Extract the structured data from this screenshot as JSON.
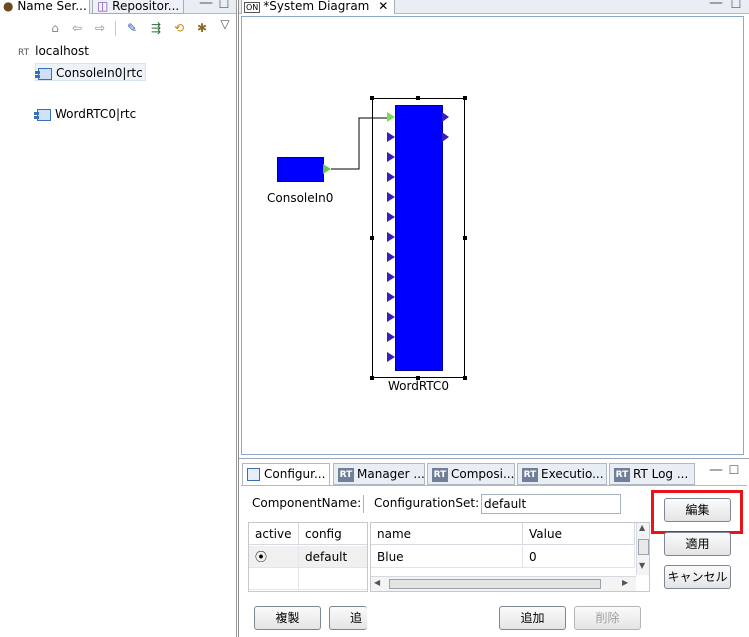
{
  "left_panel": {
    "tabs": [
      {
        "label": "Name Ser...",
        "icon": "name-service-icon"
      },
      {
        "label": "Repositor...",
        "icon": "repository-icon"
      }
    ],
    "toolbar_icons": [
      "home-icon",
      "back-icon",
      "forward-icon",
      "edit-icon",
      "filter-icon",
      "sync-icon",
      "plug-icon",
      "view-menu-icon"
    ],
    "tree": {
      "root_badge": "RT",
      "root_label": "localhost",
      "items": [
        {
          "label": "ConsoleIn0|rtc"
        },
        {
          "label": "WordRTC0|rtc"
        }
      ]
    }
  },
  "editor": {
    "tab_badge": "ON",
    "tab_title": "*System Diagram",
    "close_glyph": "✕",
    "components": [
      {
        "name": "ConsoleIn0",
        "in_ports": 0,
        "out_ports": 1
      },
      {
        "name": "WordRTC0",
        "in_ports": 13,
        "out_ports": 2
      }
    ],
    "port_colors": {
      "in": "#3b1cc0",
      "out": "#3b1cc0",
      "connected": "#7ed957"
    },
    "component_color": "#0000ff"
  },
  "bottom_panel": {
    "tabs": [
      {
        "label": "Configur...",
        "icon": "config-icon"
      },
      {
        "label": "Manager ...",
        "badge": "RT"
      },
      {
        "label": "Composi...",
        "badge": "RT"
      },
      {
        "label": "Executio...",
        "badge": "RT"
      },
      {
        "label": "RT Log ...",
        "badge": "RT"
      }
    ],
    "component_name_label": "ComponentName:",
    "configuration_set_label": "ConfigurationSet:",
    "configuration_set_value": "default",
    "config_table": {
      "headers": [
        "active",
        "config"
      ],
      "rows": [
        {
          "active_glyph": "⦿",
          "config": "default"
        }
      ]
    },
    "value_table": {
      "headers": [
        "name",
        "Value"
      ],
      "rows": [
        {
          "name": "Blue",
          "value": "0"
        }
      ]
    },
    "buttons": {
      "edit": "編集",
      "apply": "適用",
      "cancel": "キャンセル",
      "copy": "複製",
      "add_left": "追加",
      "add": "追加",
      "delete": "削除"
    },
    "highlight_color": "#e8141a"
  }
}
